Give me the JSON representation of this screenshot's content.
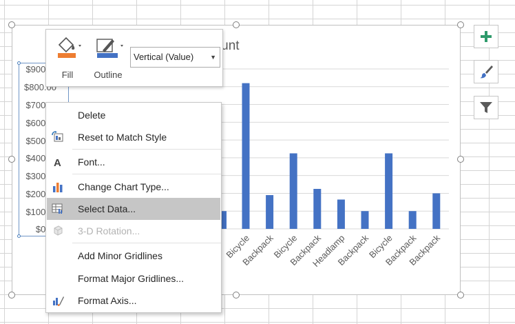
{
  "chart": {
    "title_fragment": "nount",
    "y_ticks": [
      "$900.",
      "$800.00",
      "$700.",
      "$600.",
      "$500.",
      "$400.",
      "$300.",
      "$200.",
      "$100.",
      "$0."
    ]
  },
  "chart_data": {
    "type": "bar",
    "categories": [
      "Bicycle",
      "Backpack",
      "Bicycle",
      "Backpack",
      "Headlamp",
      "Backpack",
      "Bicycle",
      "Backpack",
      "Backpack"
    ],
    "values": [
      820,
      190,
      425,
      225,
      165,
      100,
      425,
      100,
      200
    ],
    "partial_bar_value": 100,
    "ylim": [
      0,
      900
    ],
    "bar_color": "#4472c4",
    "grid": true
  },
  "mini_toolbar": {
    "fill_label": "Fill",
    "outline_label": "Outline",
    "element_selector_value": "Vertical (Value)",
    "fill_color": "#ed7d31",
    "outline_color": "#4472c4"
  },
  "side_buttons": {
    "add_icon": "plus-icon",
    "style_icon": "brush-icon",
    "filter_icon": "funnel-icon"
  },
  "context_menu": {
    "items": [
      {
        "label": "Delete",
        "icon": "none",
        "disabled": false
      },
      {
        "label": "Reset to Match Style",
        "icon": "reset-style-icon",
        "disabled": false
      },
      {
        "label": "Font...",
        "icon": "font-icon",
        "disabled": false
      },
      {
        "label": "Change Chart Type...",
        "icon": "chart-type-icon",
        "disabled": false
      },
      {
        "label": "Select Data...",
        "icon": "select-data-icon",
        "disabled": false
      },
      {
        "label": "3-D Rotation...",
        "icon": "cube-icon",
        "disabled": true
      },
      {
        "label": "Add Minor Gridlines",
        "icon": "none",
        "disabled": false
      },
      {
        "label": "Format Major Gridlines...",
        "icon": "none",
        "disabled": false
      },
      {
        "label": "Format Axis...",
        "icon": "format-axis-icon",
        "disabled": false
      }
    ]
  }
}
